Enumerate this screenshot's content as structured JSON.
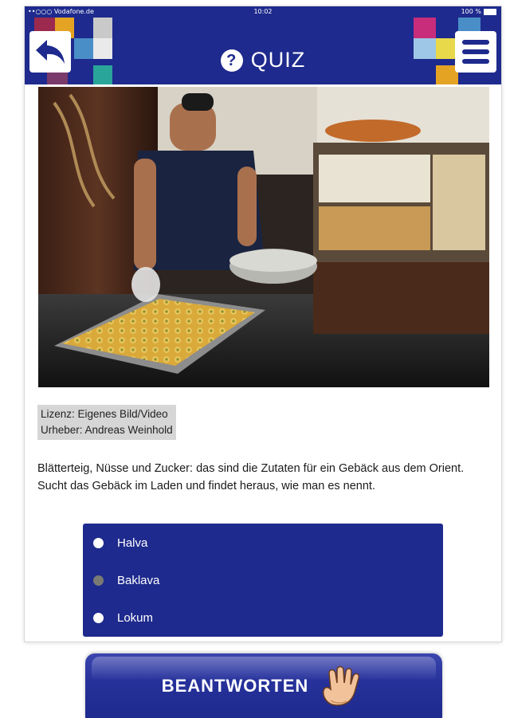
{
  "status_bar": {
    "carrier": "••○○○ Vodafone.de",
    "time": "10:02",
    "battery": "100 %"
  },
  "header": {
    "title": "QUIZ",
    "title_icon": "question-circle-icon",
    "back_icon": "back-arrow-icon",
    "menu_icon": "hamburger-menu-icon",
    "color": "#1e2a8d"
  },
  "photo": {
    "icon": "baklava-photo"
  },
  "license": {
    "line1": "Lizenz: Eigenes Bild/Video",
    "line2": "Urheber: Andreas Weinhold"
  },
  "question": {
    "line1": "Blätterteig, Nüsse und Zucker: das sind die Zutaten für ein Gebäck aus dem Orient.",
    "line2": "Sucht das Gebäck im Laden und findet heraus, wie man es nennt."
  },
  "answers": [
    {
      "label": "Halva",
      "selected": false
    },
    {
      "label": "Baklava",
      "selected": true
    },
    {
      "label": "Lokum",
      "selected": false
    }
  ],
  "submit": {
    "label": "BEANTWORTEN",
    "icon": "pointing-hand-icon"
  }
}
